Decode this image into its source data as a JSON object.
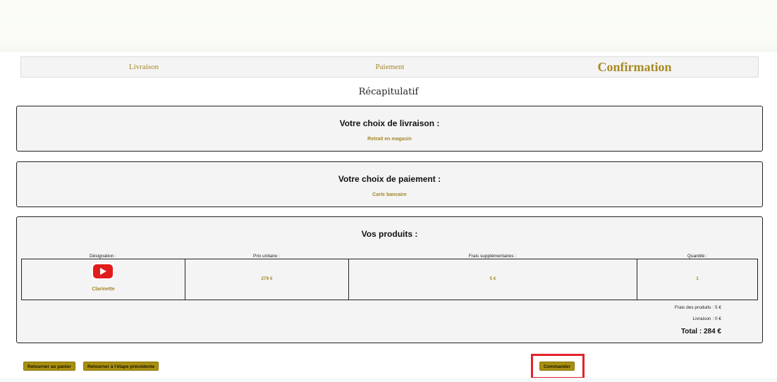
{
  "steps": {
    "livraison": "Livraison",
    "paiement": "Paiement",
    "confirmation": "Confirmation"
  },
  "recap_title": "Récapitulatif",
  "livraison_box": {
    "title": "Votre choix de livraison :",
    "value": "Retrait en magasin"
  },
  "paiement_box": {
    "title": "Votre choix de paiement :",
    "value": "Carte bancaire"
  },
  "produits_box": {
    "title": "Vos produits :",
    "columns": [
      "Désignation :",
      "Prix unitaire :",
      "Frais supplémentaires :",
      "Quantité :"
    ],
    "rows": [
      {
        "icon": "youtube-icon",
        "designation": "Clarinette",
        "prix_unitaire": "279 €",
        "frais": "5 €",
        "quantite": "1"
      }
    ],
    "frais_produits": "Frais des produits : 5 €",
    "livraison": "Livraison : 0 €",
    "total": "Total : 284 €"
  },
  "buttons": {
    "retour_panier": "Retourner au panier",
    "retour_etape": "Retourner à l'étape précédente",
    "commander": "Commander"
  },
  "colors": {
    "accent": "#a5872a",
    "button": "#a98f10",
    "highlight": "#e3222b",
    "youtube": "#e21b1b"
  }
}
